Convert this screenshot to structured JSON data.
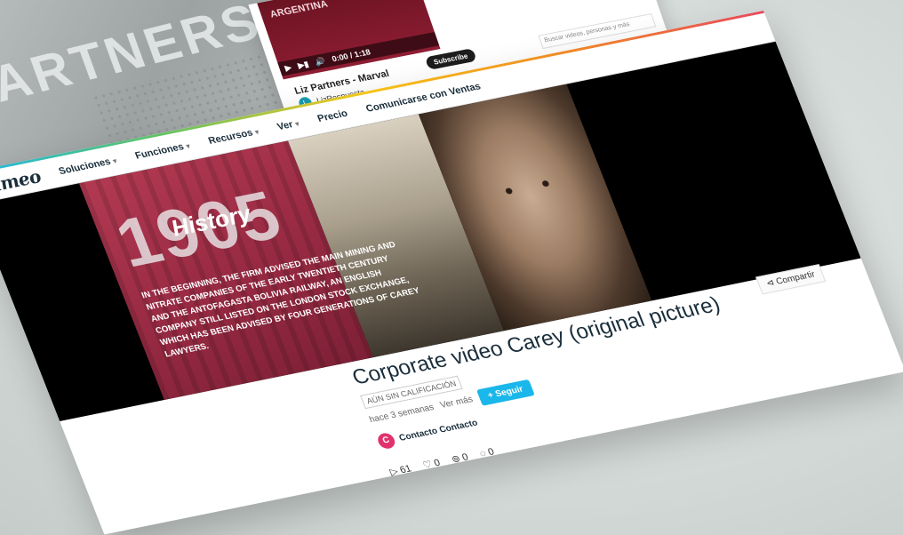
{
  "background_card": {
    "text": "ARTNERS"
  },
  "mini_window": {
    "video_overlay": "ARGENTINA",
    "time": "0:00 / 1:18",
    "title": "Liz Partners - Marval",
    "owner_initial": "L",
    "owner": "LizRespuesta",
    "subscribe_label": "Subscribe",
    "search_placeholder": "Buscar videos, personas y más"
  },
  "nav": {
    "logo": "vimeo",
    "items": [
      {
        "label": "Soluciones",
        "dropdown": true
      },
      {
        "label": "Funciones",
        "dropdown": true
      },
      {
        "label": "Recursos",
        "dropdown": true
      },
      {
        "label": "Ver",
        "dropdown": true
      },
      {
        "label": "Precio",
        "dropdown": false
      },
      {
        "label": "Comunicarse con Ventas",
        "dropdown": false
      }
    ]
  },
  "video": {
    "year": "1905",
    "heading": "History",
    "blurb": "In the beginning, the firm advised the main mining and nitrate companies of the early twentieth century and the Antofagasta Bolivia Railway, an English company still listed on the London Stock Exchange, which has been advised by four generations of Carey lawyers."
  },
  "info": {
    "title": "Corporate video Carey (original picture)",
    "rating": "AÚN SIN CALIFICACIÓN",
    "more_link": "Ver más",
    "time_ago": "hace 3 semanas",
    "follow_label": "+ Seguir",
    "owner_initial": "C",
    "owner_name": "Contacto Contacto",
    "stats": {
      "plays": "61",
      "likes": "0",
      "collections": "0",
      "comments": "0"
    },
    "share_label": "Compartir"
  },
  "colors": {
    "accent": "#1ab7ea",
    "avatar": "#e0336e",
    "hero": "#9c2c45"
  }
}
